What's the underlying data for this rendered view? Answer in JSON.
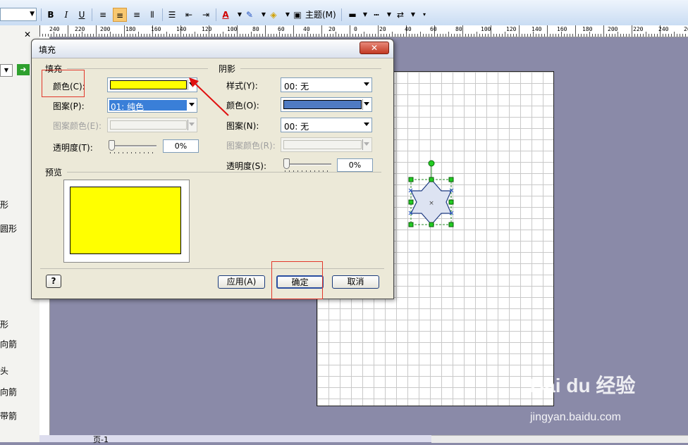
{
  "toolbar": {
    "bold": "B",
    "italic": "I",
    "underline": "U",
    "theme_label": "主题(M)"
  },
  "ruler": {
    "labels": [
      "240",
      "220",
      "200",
      "180",
      "160",
      "140",
      "120",
      "100",
      "80",
      "60",
      "40",
      "20",
      "0",
      "20",
      "40",
      "60",
      "80",
      "100",
      "120",
      "140",
      "160",
      "180",
      "200",
      "220",
      "240",
      "260"
    ]
  },
  "left_panel": {
    "items": [
      "形",
      "圆形",
      "形",
      "向箭",
      "头",
      "向箭",
      "带箭"
    ]
  },
  "dialog": {
    "title": "填充",
    "close_symbol": "✕",
    "fill": {
      "group_title": "填充",
      "color_label": "颜色(C):",
      "color_value": "#ffff00",
      "pattern_label": "图案(P):",
      "pattern_value": "01: 纯色",
      "pattern_color_label": "图案颜色(E):",
      "transparency_label": "透明度(T):",
      "transparency_value": "0%"
    },
    "shadow": {
      "group_title": "阴影",
      "style_label": "样式(Y):",
      "style_value": "00: 无",
      "color_label": "颜色(O):",
      "color_value": "#4f7bc3",
      "pattern_label": "图案(N):",
      "pattern_value": "00: 无",
      "pattern_color_label": "图案颜色(R):",
      "transparency_label": "透明度(S):",
      "transparency_value": "0%"
    },
    "preview": {
      "group_title": "预览",
      "fill_color": "#ffff00"
    },
    "buttons": {
      "help": "?",
      "apply": "应用(A)",
      "ok": "确定",
      "cancel": "取消"
    }
  },
  "page_tab": "页-1",
  "watermark": {
    "logo": "Bai du 经验",
    "url": "jingyan.baidu.com"
  }
}
